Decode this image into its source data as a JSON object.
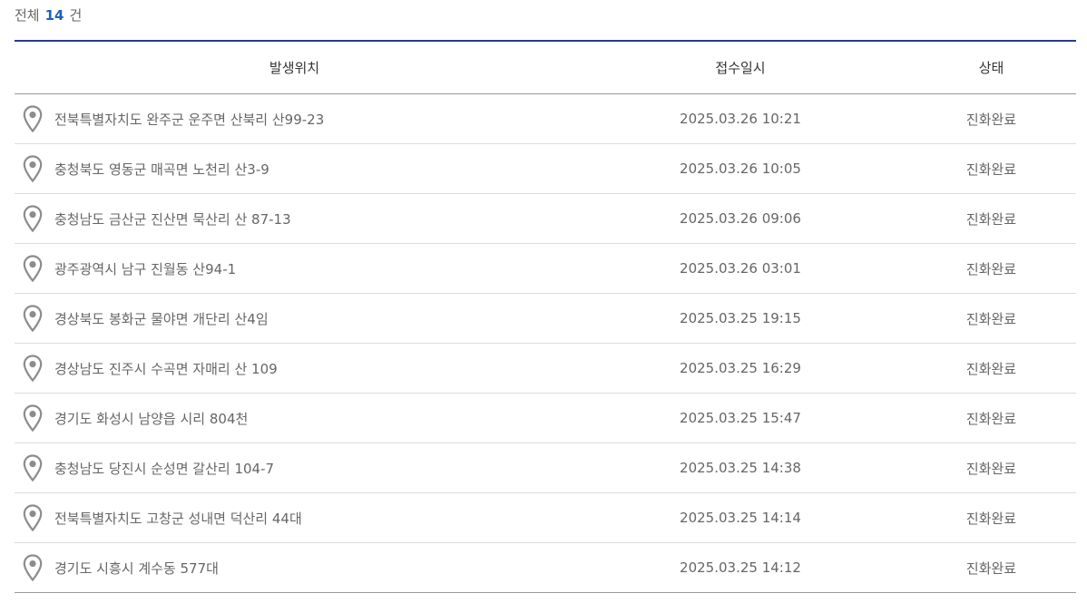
{
  "summary": {
    "prefix": "전체",
    "count": "14",
    "suffix": "건"
  },
  "columns": {
    "location": "발생위치",
    "date": "접수일시",
    "status": "상태"
  },
  "icons": {
    "location_marker": "map-pin-icon"
  },
  "colors": {
    "accent": "#1a63b8",
    "header_border": "#2b3a8f",
    "pin": "#8c8c8c"
  },
  "rows": [
    {
      "location": "전북특별자치도 완주군 운주면 산북리 산99-23",
      "date": "2025.03.26 10:21",
      "status": "진화완료"
    },
    {
      "location": "충청북도 영동군 매곡면 노천리 산3-9",
      "date": "2025.03.26 10:05",
      "status": "진화완료"
    },
    {
      "location": "충청남도 금산군 진산면 묵산리 산 87-13",
      "date": "2025.03.26 09:06",
      "status": "진화완료"
    },
    {
      "location": "광주광역시 남구 진월동 산94-1",
      "date": "2025.03.26 03:01",
      "status": "진화완료"
    },
    {
      "location": "경상북도 봉화군 물야면 개단리 산4임",
      "date": "2025.03.25 19:15",
      "status": "진화완료"
    },
    {
      "location": "경상남도 진주시 수곡면 자매리 산 109",
      "date": "2025.03.25 16:29",
      "status": "진화완료"
    },
    {
      "location": "경기도 화성시 남양읍 시리 804천",
      "date": "2025.03.25 15:47",
      "status": "진화완료"
    },
    {
      "location": "충청남도 당진시 순성면 갈산리 104-7",
      "date": "2025.03.25 14:38",
      "status": "진화완료"
    },
    {
      "location": "전북특별자치도 고창군 성내면 덕산리 44대",
      "date": "2025.03.25 14:14",
      "status": "진화완료"
    },
    {
      "location": "경기도 시흥시 계수동 577대",
      "date": "2025.03.25 14:12",
      "status": "진화완료"
    }
  ]
}
